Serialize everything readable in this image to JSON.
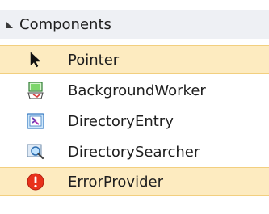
{
  "toolbox": {
    "category": {
      "label": "Components",
      "expanded": true
    },
    "items": [
      {
        "label": "Pointer",
        "icon": "pointer-arrow-icon",
        "selected": true
      },
      {
        "label": "BackgroundWorker",
        "icon": "background-worker-icon",
        "selected": false
      },
      {
        "label": "DirectoryEntry",
        "icon": "directory-entry-icon",
        "selected": false
      },
      {
        "label": "DirectorySearcher",
        "icon": "directory-searcher-icon",
        "selected": false
      },
      {
        "label": "ErrorProvider",
        "icon": "error-provider-icon",
        "selected": true
      }
    ],
    "colors": {
      "header_bg": "#eef0f4",
      "selected_bg": "#fdebc0",
      "selected_border": "#f2cf7f",
      "error_red": "#e8311b"
    }
  }
}
